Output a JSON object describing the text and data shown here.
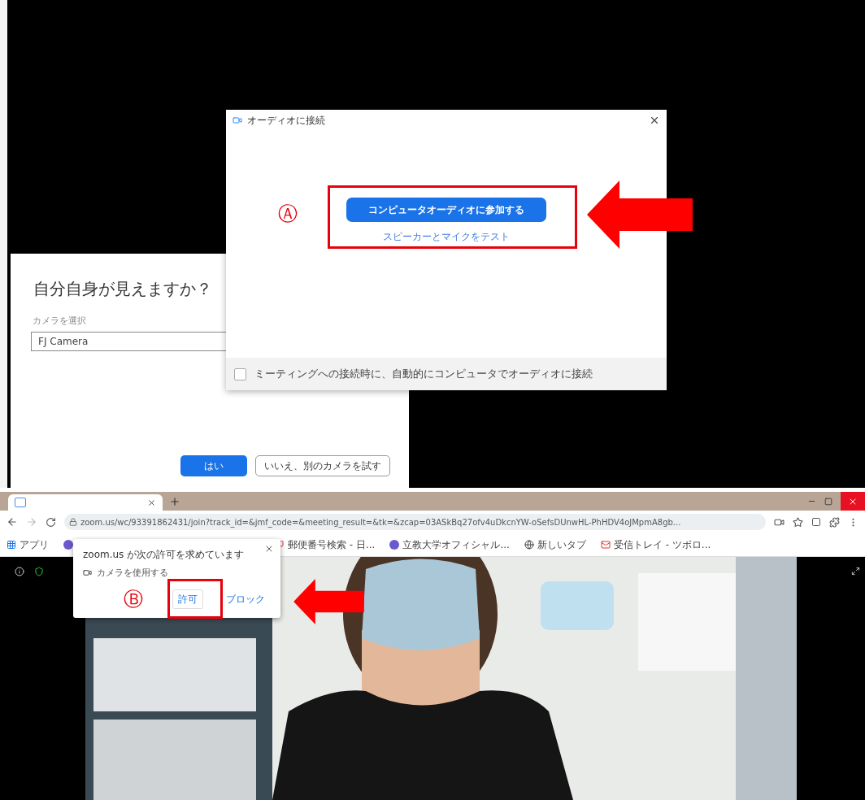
{
  "camera_dialog": {
    "title": "自分自身が見えますか？",
    "field_label": "カメラを選択",
    "camera_field": {
      "value": "FJ Camera"
    },
    "buttons": [
      {
        "label": "はい",
        "kind": "primary"
      },
      {
        "label": "いいえ、別のカメラを試す",
        "kind": "secondary"
      }
    ]
  },
  "audio_dialog": {
    "title": "オーディオに接続",
    "join_button": "コンピュータオーディオに参加する",
    "test_link": "スピーカーとマイクをテスト",
    "auto_connect": {
      "label": "ミーティングへの接続時に、自動的にコンピュータでオーディオに接続",
      "checked": false
    }
  },
  "annotations": [
    {
      "label": "Ⓐ"
    },
    {
      "label": "Ⓑ"
    }
  ],
  "browser": {
    "url": "zoom.us/wc/93391862431/join?track_id=&jmf_code=&meeting_result=&tk=&zcap=03ASkBq27ofv4uDkcnYW-oSefsDUnwHL-PhHDV4oJMpmA8gb...",
    "bookmarks": [
      {
        "label": "アプリ",
        "kind": "apps"
      },
      {
        "label": "郵便番号検索 - 日...",
        "kind": "flag"
      },
      {
        "label": "立教大学オフィシャル...",
        "kind": "circle"
      },
      {
        "label": "新しいタブ",
        "kind": "globe"
      },
      {
        "label": "受信トレイ - ツボロ...",
        "kind": "mail"
      }
    ],
    "permission_popup": {
      "title": "zoom.us が次の許可を求めています",
      "item": "カメラを使用する",
      "buttons": [
        {
          "label": "許可",
          "kind": "secondary"
        },
        {
          "label": "ブロック",
          "kind": "link"
        }
      ]
    }
  }
}
